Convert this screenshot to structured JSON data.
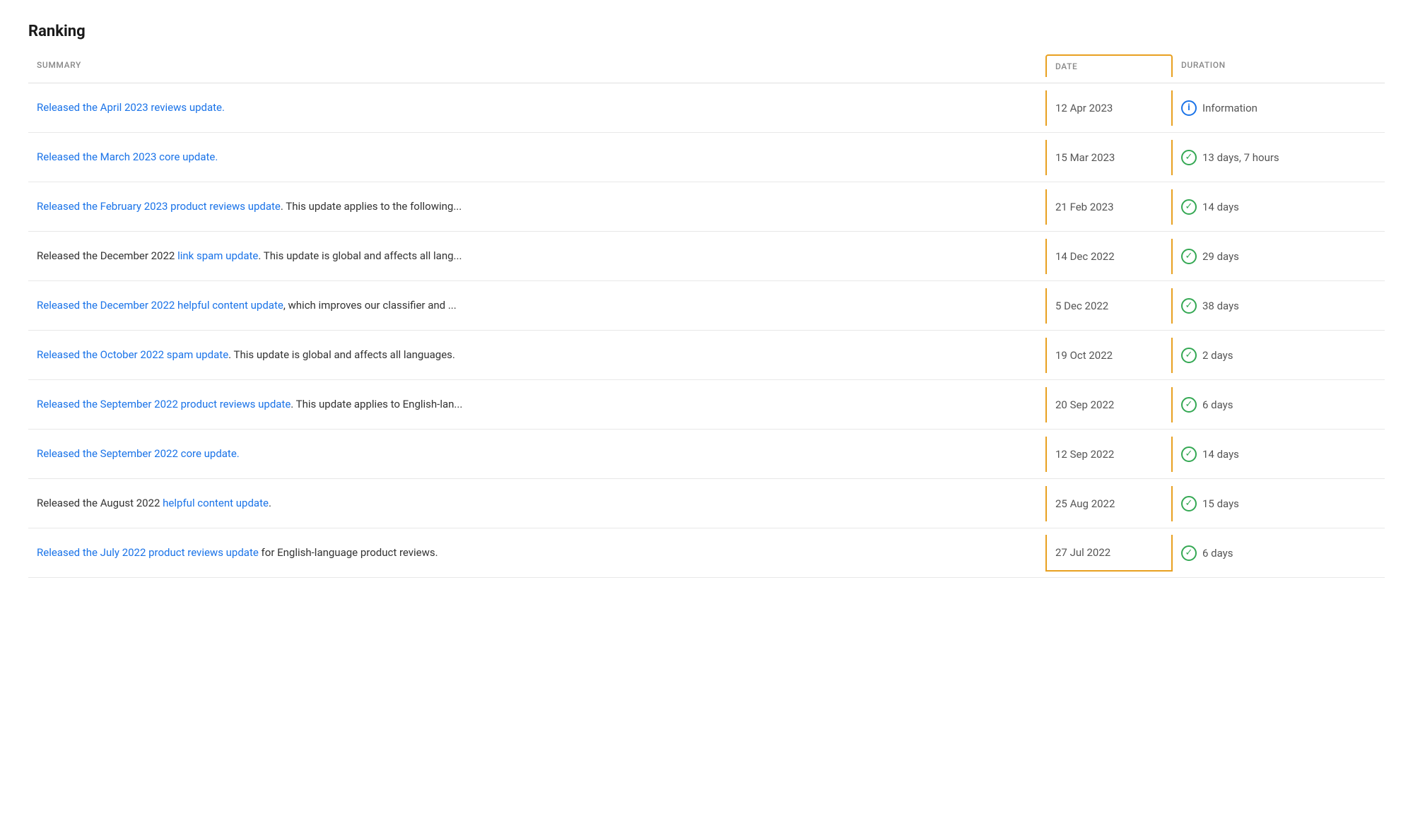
{
  "title": "Ranking",
  "columns": {
    "summary": "SUMMARY",
    "date": "DATE",
    "duration": "DURATION"
  },
  "rows": [
    {
      "summary_parts": [
        {
          "text": "Released the April 2023 reviews update.",
          "type": "link"
        }
      ],
      "date": "12 Apr 2023",
      "duration_text": "Information",
      "duration_type": "info"
    },
    {
      "summary_parts": [
        {
          "text": "Released the March 2023 core update.",
          "type": "link"
        }
      ],
      "date": "15 Mar 2023",
      "duration_text": "13 days, 7 hours",
      "duration_type": "check"
    },
    {
      "summary_parts": [
        {
          "text": "Released the February 2023 product reviews update",
          "type": "link"
        },
        {
          "text": ". This update applies to the following...",
          "type": "plain"
        }
      ],
      "date": "21 Feb 2023",
      "duration_text": "14 days",
      "duration_type": "check"
    },
    {
      "summary_parts": [
        {
          "text": "Released",
          "type": "plain"
        },
        {
          "text": " the December 2022 ",
          "type": "plain"
        },
        {
          "text": "link spam update",
          "type": "link"
        },
        {
          "text": ". This update is global and affects all lang...",
          "type": "plain"
        }
      ],
      "date": "14 Dec 2022",
      "duration_text": "29 days",
      "duration_type": "check"
    },
    {
      "summary_parts": [
        {
          "text": "Released the December 2022 helpful content update",
          "type": "link"
        },
        {
          "text": ", which improves our classifier and ...",
          "type": "plain"
        }
      ],
      "date": "5 Dec 2022",
      "duration_text": "38 days",
      "duration_type": "check"
    },
    {
      "summary_parts": [
        {
          "text": "Released the October 2022 spam update",
          "type": "link"
        },
        {
          "text": ". This update is global and affects all languages.",
          "type": "plain"
        }
      ],
      "date": "19 Oct 2022",
      "duration_text": "2 days",
      "duration_type": "check"
    },
    {
      "summary_parts": [
        {
          "text": "Released the September 2022 product reviews update",
          "type": "link"
        },
        {
          "text": ". This update applies to English-lan...",
          "type": "plain"
        }
      ],
      "date": "20 Sep 2022",
      "duration_text": "6 days",
      "duration_type": "check"
    },
    {
      "summary_parts": [
        {
          "text": "Released the September 2022 core update.",
          "type": "link"
        }
      ],
      "date": "12 Sep 2022",
      "duration_text": "14 days",
      "duration_type": "check"
    },
    {
      "summary_parts": [
        {
          "text": "Released",
          "type": "plain"
        },
        {
          "text": " the August 2022 ",
          "type": "plain"
        },
        {
          "text": "helpful content update",
          "type": "link"
        },
        {
          "text": ".",
          "type": "plain"
        }
      ],
      "date": "25 Aug 2022",
      "duration_text": "15 days",
      "duration_type": "check"
    },
    {
      "summary_parts": [
        {
          "text": "Released the July 2022 product reviews update",
          "type": "link"
        },
        {
          "text": " for English-language product reviews.",
          "type": "plain"
        }
      ],
      "date": "27 Jul 2022",
      "duration_text": "6 days",
      "duration_type": "check"
    }
  ],
  "colors": {
    "link": "#1a73e8",
    "check": "#34a853",
    "info": "#1a73e8",
    "date_border": "#e8a020",
    "row_border": "#e8e8e8",
    "header_text": "#888",
    "text": "#555",
    "title": "#1a1a1a"
  }
}
